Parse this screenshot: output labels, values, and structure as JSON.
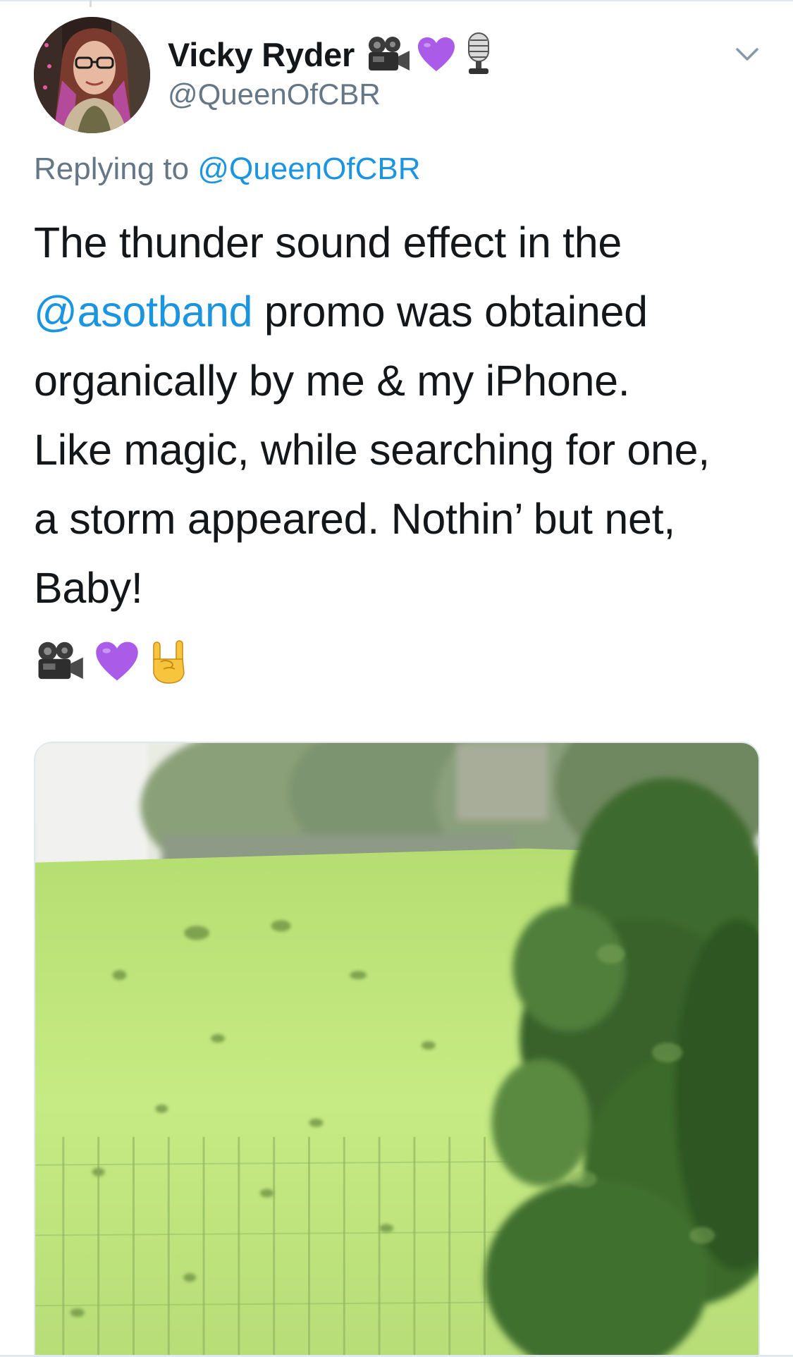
{
  "tweet": {
    "author": {
      "display_name": "Vicky Ryder",
      "handle": "@QueenOfCBR",
      "name_emojis": [
        "movie-camera-icon",
        "purple-heart-icon",
        "microphone-icon"
      ]
    },
    "reply_prefix": "Replying to",
    "reply_to": "@QueenOfCBR",
    "text_lines": [
      [
        "The thunder sound effect in the"
      ],
      [
        "@asotband",
        " promo was obtained"
      ],
      [
        "organically by me & my iPhone."
      ],
      [
        "Like magic, while searching for one,"
      ],
      [
        "a storm appeared. Nothin’ but net,"
      ],
      [
        "Baby!"
      ]
    ],
    "mention": "@asotband",
    "trailing_emojis": [
      "movie-camera-icon",
      "purple-heart-icon",
      "sign-of-horns-icon"
    ],
    "media": {
      "type": "video-thumbnail",
      "subject": "green field with trees and fence"
    }
  },
  "colors": {
    "text": "#14171a",
    "secondary": "#657786",
    "link": "#1b95e0",
    "purple_heart": "#aa5ce9",
    "divider": "#e1e8ed"
  }
}
